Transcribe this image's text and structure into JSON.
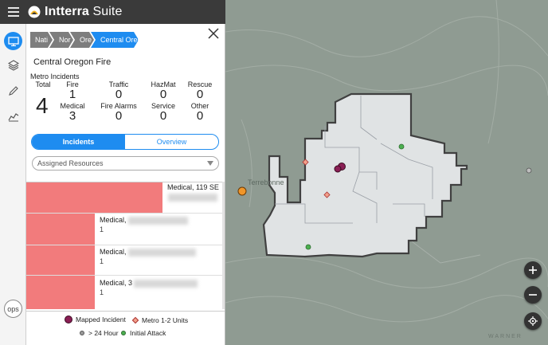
{
  "app": {
    "brand": "Intterra",
    "suffix": "Suite"
  },
  "breadcrumb": [
    "Nati",
    "Nor",
    "Ore",
    "Central Oreg"
  ],
  "agency_name": "Central Oregon Fire",
  "metro": {
    "title": "Metro Incidents",
    "total": {
      "label": "Total",
      "value": "4"
    },
    "stats": [
      {
        "label": "Fire",
        "value": "1"
      },
      {
        "label": "Traffic",
        "value": "0"
      },
      {
        "label": "HazMat",
        "value": "0"
      },
      {
        "label": "Rescue",
        "value": "0"
      },
      {
        "label": "Medical",
        "value": "3"
      },
      {
        "label": "Fire Alarms",
        "value": "0"
      },
      {
        "label": "Service",
        "value": "0"
      },
      {
        "label": "Other",
        "value": "0"
      }
    ]
  },
  "tabs": {
    "incidents": "Incidents",
    "overview": "Overview"
  },
  "dropdown": {
    "selected": "Assigned Resources"
  },
  "incidents": [
    {
      "title": "Medical, 119 SE",
      "count": ""
    },
    {
      "title": "Medical,",
      "count": "1"
    },
    {
      "title": "Medical,",
      "count": "1"
    },
    {
      "title": "Medical, 3",
      "count": "1"
    }
  ],
  "legend": {
    "mapped": "Mapped Incident",
    "metro": "Metro 1-2 Units",
    "hour": "> 24 Hour",
    "initial": "Initial Attack"
  },
  "map": {
    "label_terrebonne": "Terrebonne",
    "label_warner": "WARNER"
  },
  "colors": {
    "accent": "#1e8cf0",
    "incident_bar": "#f27b7c",
    "topbar": "#3a3a3a"
  },
  "ops": "ops"
}
